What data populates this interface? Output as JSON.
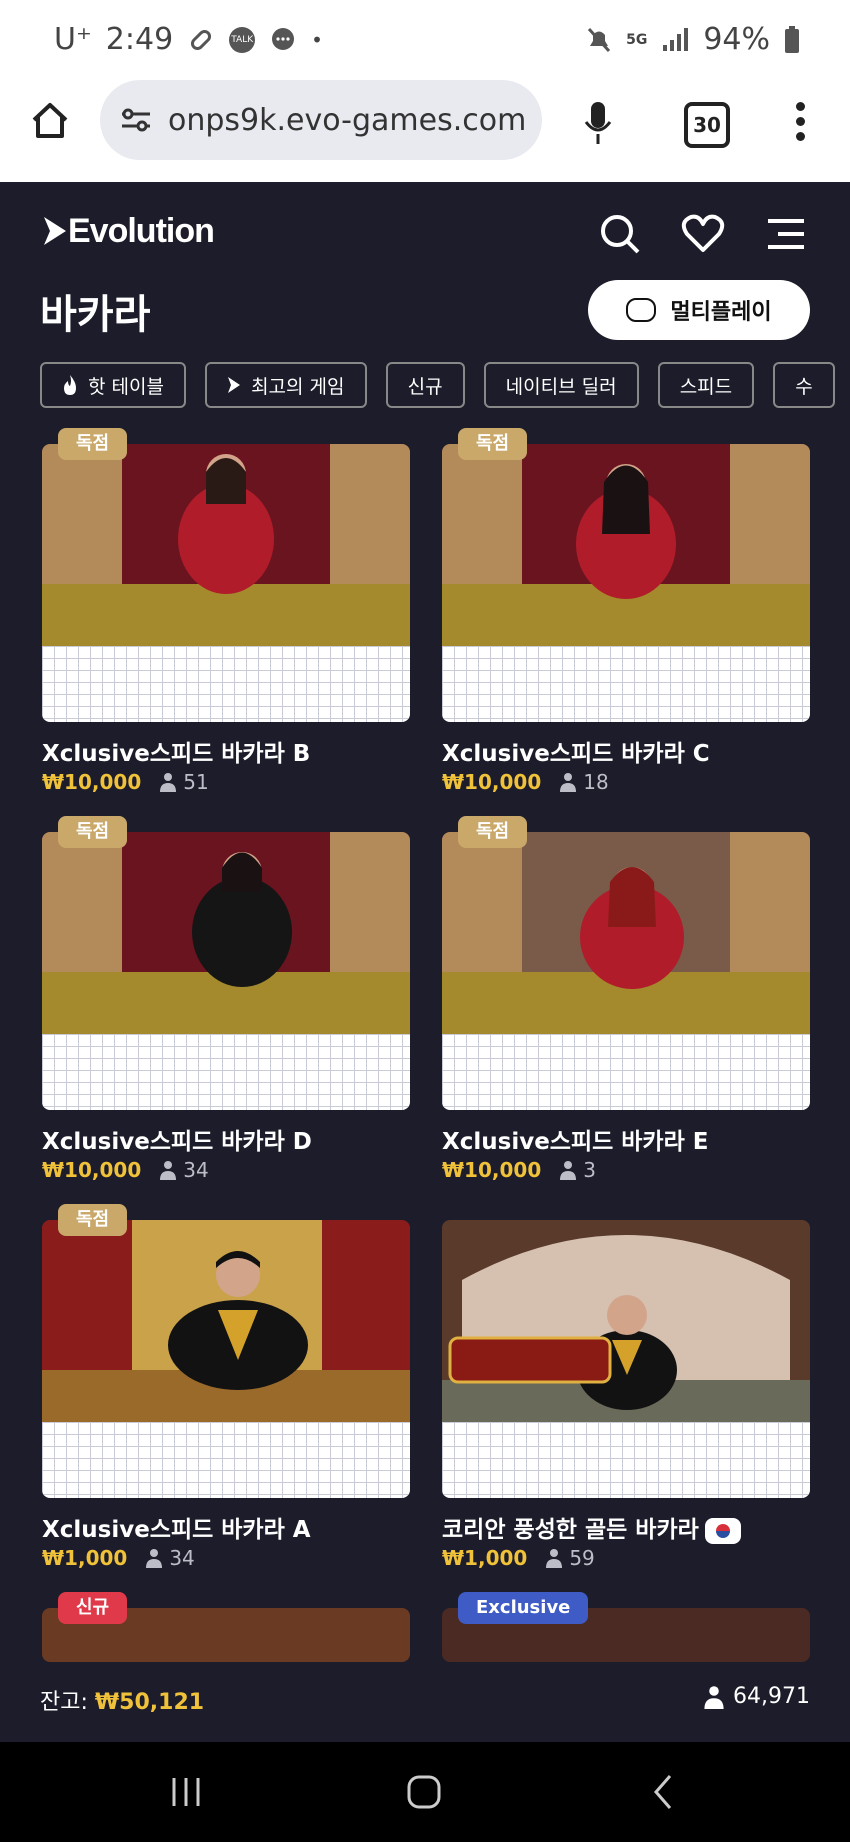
{
  "status_bar": {
    "carrier": "U⁺",
    "time": "2:49",
    "talk": "TALK",
    "battery": "94%",
    "network": "5G"
  },
  "browser": {
    "url": "onps9k.evo-games.com",
    "tab_count": "30"
  },
  "app": {
    "logo": "Evolution",
    "section_title": "바카라",
    "multiplay_label": "멀티플레이",
    "filters": [
      "핫 테이블",
      "최고의 게임",
      "신규",
      "네이티브 딜러",
      "스피드",
      "수"
    ]
  },
  "tables": [
    {
      "badge": "독점",
      "title": "Xclusive스피드 바카라 B",
      "bet": "₩10,000",
      "players": "51"
    },
    {
      "badge": "독점",
      "title": "Xclusive스피드 바카라 C",
      "bet": "₩10,000",
      "players": "18"
    },
    {
      "badge": "독점",
      "title": "Xclusive스피드 바카라 D",
      "bet": "₩10,000",
      "players": "34"
    },
    {
      "badge": "독점",
      "title": "Xclusive스피드 바카라 E",
      "bet": "₩10,000",
      "players": "3"
    },
    {
      "badge": "독점",
      "title": "Xclusive스피드 바카라 A",
      "bet": "₩1,000",
      "players": "34"
    },
    {
      "badge": "",
      "title": "코리안 풍성한 골든 바카라",
      "bet": "₩1,000",
      "players": "59"
    },
    {
      "badge": "신규",
      "title": "",
      "bet": "",
      "players": ""
    },
    {
      "badge": "Exclusive",
      "title": "",
      "bet": "",
      "players": ""
    }
  ],
  "footer": {
    "balance_label": "잔고:",
    "balance_value": "₩50,121",
    "total_players": "64,971"
  },
  "colors": {
    "background": "#1c1c2a",
    "gold": "#f0c23a",
    "badge_gold": "#c9a86a",
    "badge_new": "#e03a4a",
    "badge_exclusive": "#3f5bc6"
  }
}
